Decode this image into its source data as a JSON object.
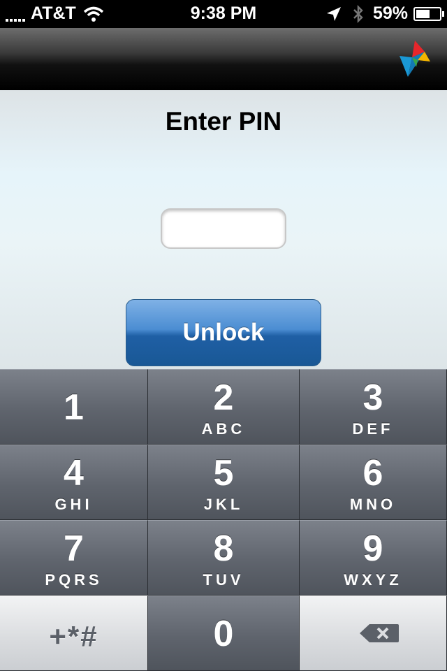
{
  "status_bar": {
    "carrier": "AT&T",
    "time": "9:38 PM",
    "battery_percent": "59%",
    "battery_level": 0.59,
    "icons": [
      "signal-icon",
      "wifi-icon",
      "location-icon",
      "bluetooth-icon",
      "battery-icon"
    ]
  },
  "nav_bar": {
    "logo_icon": "app-logo-icon"
  },
  "screen": {
    "title": "Enter PIN",
    "pin_value": "",
    "unlock_label": "Unlock"
  },
  "keypad": {
    "keys": [
      {
        "number": "1",
        "letters": ""
      },
      {
        "number": "2",
        "letters": "ABC"
      },
      {
        "number": "3",
        "letters": "DEF"
      },
      {
        "number": "4",
        "letters": "GHI"
      },
      {
        "number": "5",
        "letters": "JKL"
      },
      {
        "number": "6",
        "letters": "MNO"
      },
      {
        "number": "7",
        "letters": "PQRS"
      },
      {
        "number": "8",
        "letters": "TUV"
      },
      {
        "number": "9",
        "letters": "WXYZ"
      }
    ],
    "symbols_label": "+*#",
    "zero": "0",
    "backspace_icon": "backspace-icon"
  },
  "colors": {
    "unlock_button": "#3a7bc2",
    "keypad_key": "#6a6f78",
    "keypad_light_key": "#dcdee1"
  }
}
